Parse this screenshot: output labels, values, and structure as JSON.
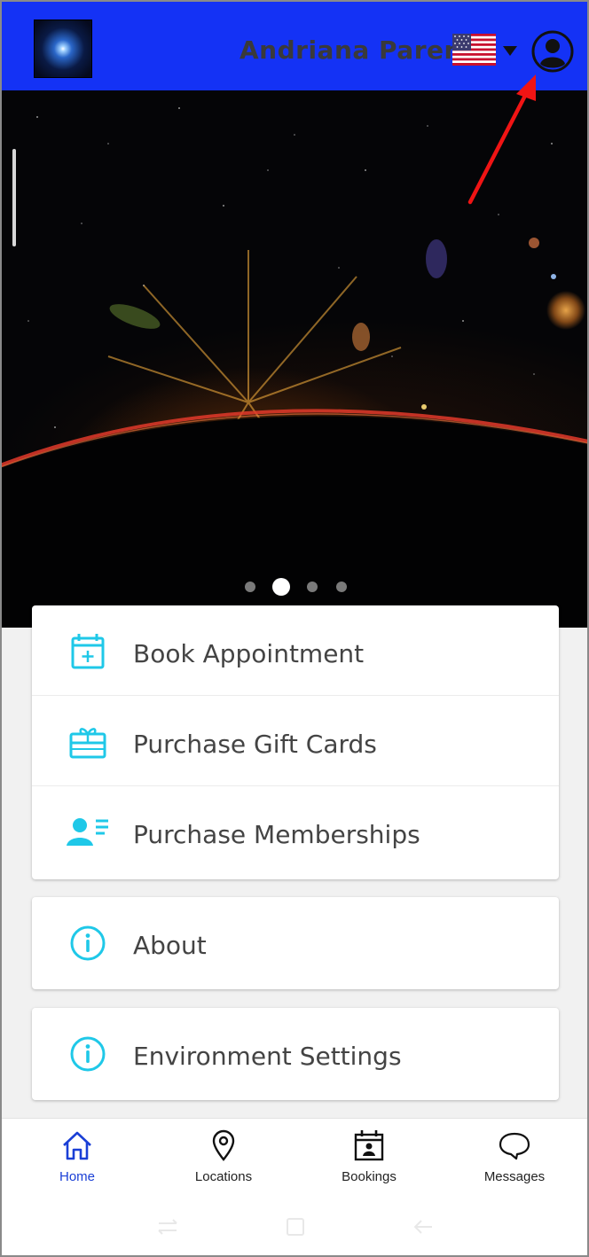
{
  "header": {
    "user_name": "Andriana Parent",
    "language_flag": "us-flag-icon",
    "brand_color": "#1432f5"
  },
  "hero": {
    "carousel_pages": 4,
    "active_page": 2
  },
  "menu_primary": {
    "items": [
      {
        "label": "Book Appointment",
        "icon": "calendar-plus-icon"
      },
      {
        "label": "Purchase Gift Cards",
        "icon": "gift-card-icon"
      },
      {
        "label": "Purchase Memberships",
        "icon": "membership-card-icon"
      }
    ]
  },
  "menu_about": {
    "label": "About",
    "icon": "info-icon"
  },
  "menu_environment": {
    "label": "Environment Settings",
    "icon": "info-icon"
  },
  "accent_color": "#1fc8e8",
  "bottom_nav": {
    "items": [
      {
        "label": "Home",
        "icon": "home-icon",
        "active": true
      },
      {
        "label": "Locations",
        "icon": "location-pin-icon",
        "active": false
      },
      {
        "label": "Bookings",
        "icon": "bookings-calendar-icon",
        "active": false
      },
      {
        "label": "Messages",
        "icon": "chat-bubble-icon",
        "active": false
      }
    ],
    "active_color": "#1a3fd6"
  }
}
